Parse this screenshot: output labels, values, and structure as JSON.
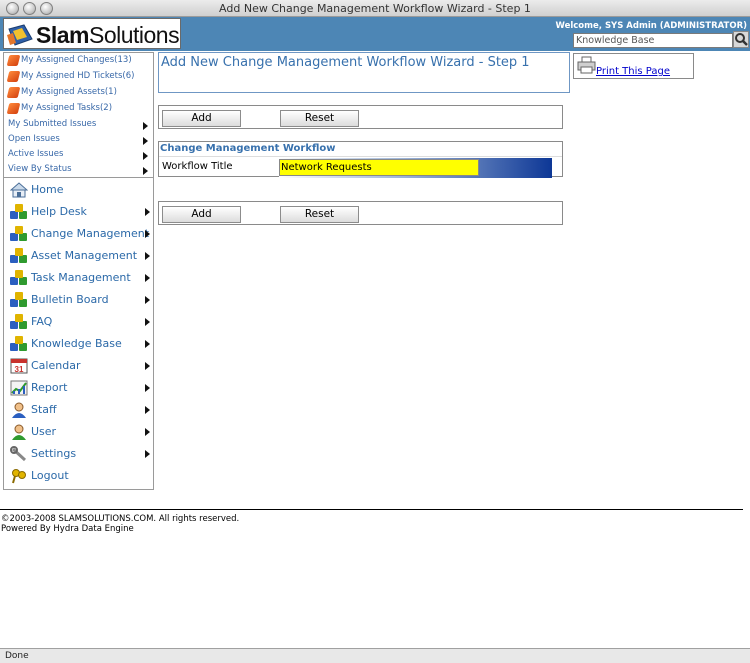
{
  "window": {
    "title": "Add New Change Management Workflow Wizard - Step 1"
  },
  "header": {
    "logo_text": "Slam Solutions",
    "welcome": "Welcome, SYS Admin (ADMINISTRATOR)",
    "search_value": "Knowledge Base",
    "bg_color": "#4d86b5"
  },
  "quick_links": [
    {
      "label": "My Assigned Changes(13)"
    },
    {
      "label": "My Assigned HD Tickets(6)"
    },
    {
      "label": "My Assigned Assets(1)"
    },
    {
      "label": "My Assigned Tasks(2)"
    }
  ],
  "issues": [
    {
      "label": "My Submitted Issues"
    },
    {
      "label": "Open Issues"
    },
    {
      "label": "Active Issues"
    },
    {
      "label": "View By Status"
    }
  ],
  "menu": [
    {
      "label": "Home",
      "icon": "home-icon"
    },
    {
      "label": "Help Desk",
      "icon": "cubes-icon"
    },
    {
      "label": "Change Management",
      "icon": "cubes-icon"
    },
    {
      "label": "Asset Management",
      "icon": "cubes-icon"
    },
    {
      "label": "Task Management",
      "icon": "cubes-icon"
    },
    {
      "label": "Bulletin Board",
      "icon": "cubes-icon"
    },
    {
      "label": "FAQ",
      "icon": "cubes-icon"
    },
    {
      "label": "Knowledge Base",
      "icon": "cubes-icon"
    },
    {
      "label": "Calendar",
      "icon": "calendar-icon",
      "icon_text": "31"
    },
    {
      "label": "Report",
      "icon": "chart-icon"
    },
    {
      "label": "Staff",
      "icon": "staff-icon"
    },
    {
      "label": "User",
      "icon": "user-icon"
    },
    {
      "label": "Settings",
      "icon": "wrench-icon"
    },
    {
      "label": "Logout",
      "icon": "keys-icon"
    }
  ],
  "main": {
    "wizard_title": "Add New Change Management Workflow Wizard - Step 1",
    "add_label": "Add",
    "reset_label": "Reset",
    "section_title": "Change Management Workflow",
    "workflow_title_label": "Workflow Title",
    "workflow_title_value": "Network Requests"
  },
  "print": {
    "label": "Print This Page"
  },
  "footer": {
    "copyright": "©2003-2008 SLAMSOLUTIONS.COM. All rights reserved.",
    "powered": "Powered By Hydra Data Engine"
  },
  "status": {
    "text": "Done"
  }
}
